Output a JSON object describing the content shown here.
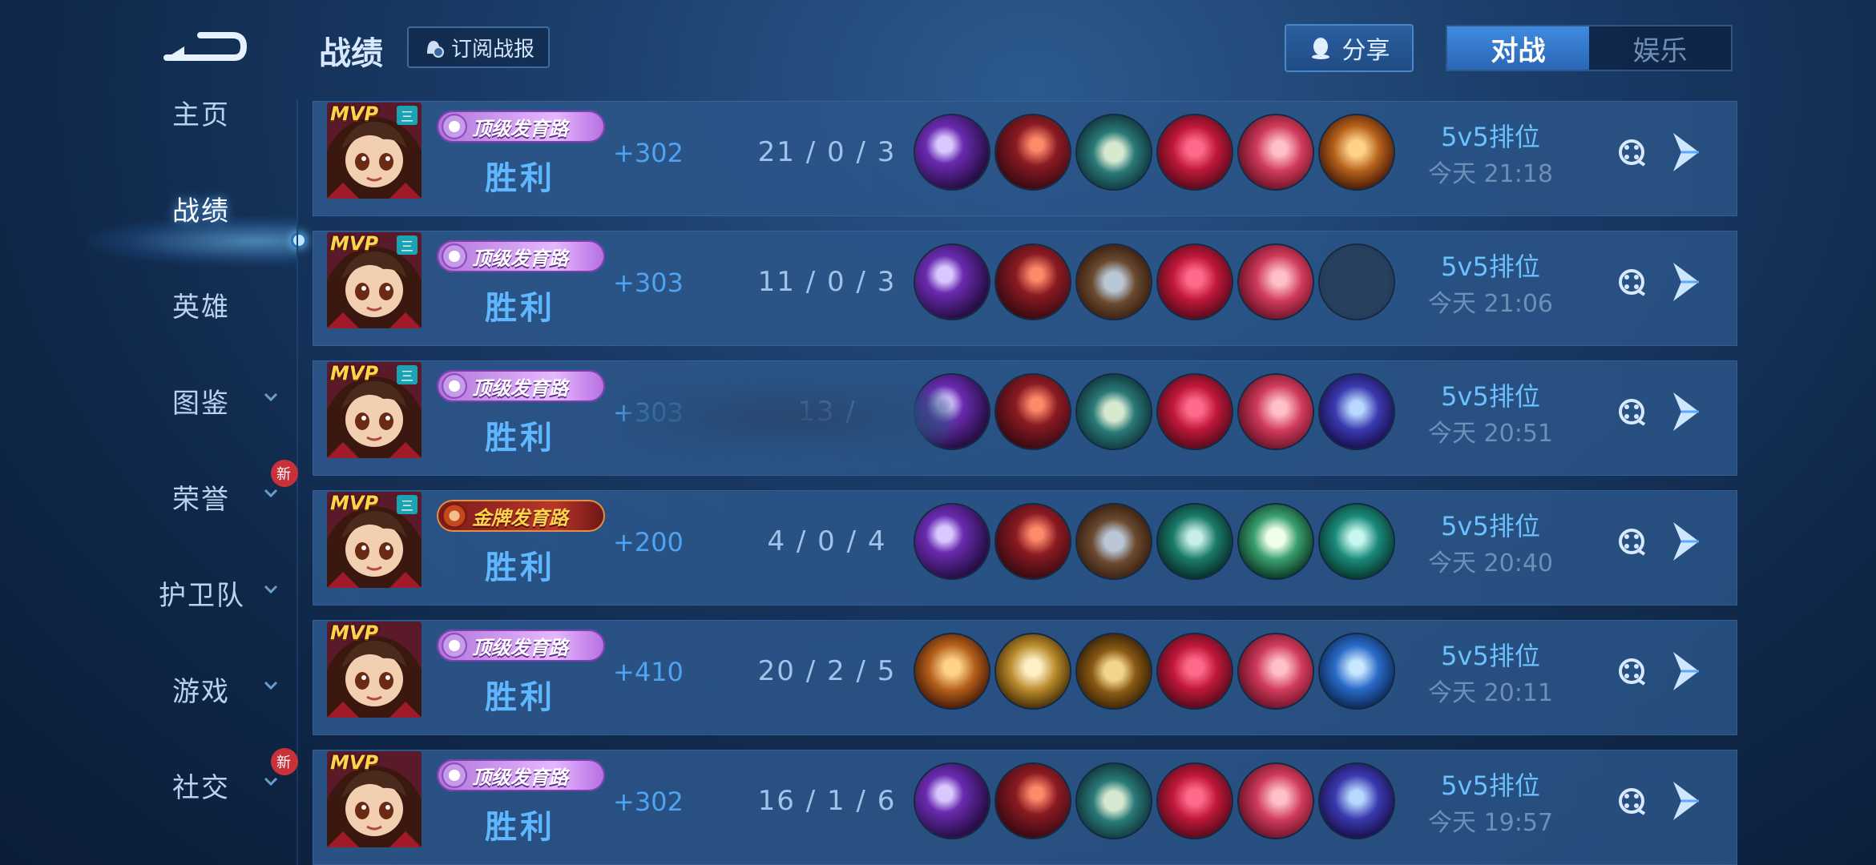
{
  "header": {
    "title": "战绩",
    "subscribe_label": "订阅战报",
    "share_label": "分享",
    "tabs": [
      {
        "label": "对战",
        "active": true
      },
      {
        "label": "娱乐",
        "active": false
      }
    ]
  },
  "sidebar": {
    "items": [
      {
        "label": "主页",
        "active": false,
        "chevron": false,
        "badge": ""
      },
      {
        "label": "战绩",
        "active": true,
        "chevron": false,
        "badge": ""
      },
      {
        "label": "英雄",
        "active": false,
        "chevron": false,
        "badge": ""
      },
      {
        "label": "图鉴",
        "active": false,
        "chevron": true,
        "badge": ""
      },
      {
        "label": "荣誉",
        "active": false,
        "chevron": true,
        "badge": "新"
      },
      {
        "label": "护卫队",
        "active": false,
        "chevron": true,
        "badge": ""
      },
      {
        "label": "游戏",
        "active": false,
        "chevron": true,
        "badge": ""
      },
      {
        "label": "社交",
        "active": false,
        "chevron": true,
        "badge": "新"
      }
    ]
  },
  "colors": {
    "accent": "#5fb7ff",
    "background": "#1a3c68",
    "row": "#2c568a",
    "badge_red": "#c8313a"
  },
  "records": [
    {
      "mvp": "MVP",
      "rank_mark": "三",
      "title": "顶级发育路",
      "title_style": "purple",
      "result": "胜利",
      "score": "+302",
      "kda": "21 / 0 / 3",
      "items": [
        "bow-purple",
        "blade-red",
        "boots-teal",
        "wings-red",
        "spear-pink",
        "sword-gold"
      ],
      "mode": "5v5排位",
      "time": "今天 21:18"
    },
    {
      "mvp": "MVP",
      "rank_mark": "三",
      "title": "顶级发育路",
      "title_style": "purple",
      "result": "胜利",
      "score": "+303",
      "kda": "11 / 0 / 3",
      "items": [
        "bow-purple",
        "blade-red",
        "boots-bronze",
        "wings-red",
        "spear-pink",
        "empty"
      ],
      "mode": "5v5排位",
      "time": "今天 21:06"
    },
    {
      "mvp": "MVP",
      "rank_mark": "三",
      "title": "顶级发育路",
      "title_style": "purple",
      "result": "胜利",
      "score": "+303",
      "kda": "13 /",
      "blurred": true,
      "items": [
        "bow-purple",
        "blade-red",
        "boots-teal",
        "wings-red",
        "spear-pink",
        "trident-blue"
      ],
      "mode": "5v5排位",
      "time": "今天 20:51"
    },
    {
      "mvp": "MVP",
      "rank_mark": "三",
      "title": "金牌发育路",
      "title_style": "red",
      "result": "胜利",
      "score": "+200",
      "kda": "4 / 0 / 4",
      "items": [
        "bow-purple",
        "blade-red",
        "boots-bronze",
        "sword-green",
        "feather-green",
        "dagger-green"
      ],
      "mode": "5v5排位",
      "time": "今天 20:40"
    },
    {
      "mvp": "MVP",
      "rank_mark": "",
      "title": "顶级发育路",
      "title_style": "purple",
      "result": "胜利",
      "score": "+410",
      "kda": "20 / 2 / 5",
      "items": [
        "sword-gold",
        "blade-gold",
        "boots-gold",
        "wings-red",
        "spear-pink",
        "bow-blue"
      ],
      "mode": "5v5排位",
      "time": "今天 20:11"
    },
    {
      "mvp": "MVP",
      "rank_mark": "",
      "title": "顶级发育路",
      "title_style": "purple",
      "result": "胜利",
      "score": "+302",
      "kda": "16 / 1 / 6",
      "items": [
        "bow-purple",
        "blade-red",
        "boots-teal",
        "wings-red",
        "spear-pink",
        "trident-blue"
      ],
      "mode": "5v5排位",
      "time": "今天 19:57"
    }
  ]
}
